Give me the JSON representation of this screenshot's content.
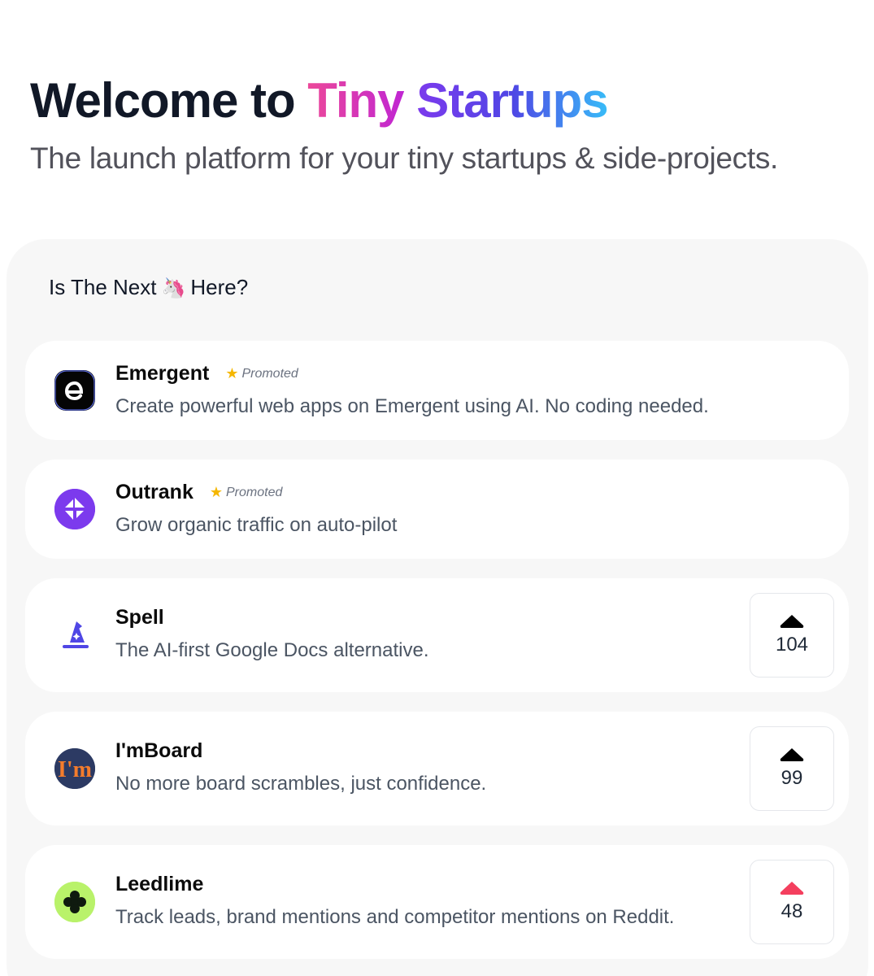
{
  "hero": {
    "title_prefix": "Welcome to ",
    "title_word1": "Tiny",
    "title_word2": "Startups",
    "subtitle": "The launch platform for your tiny startups & side-projects."
  },
  "section": {
    "title_before": "Is The Next",
    "emoji": "🦄",
    "title_after": "Here?"
  },
  "promoted_label": "Promoted",
  "products": [
    {
      "name": "Emergent",
      "description": "Create powerful web apps on Emergent using AI. No coding needed.",
      "promoted": true,
      "logo_icon": "emergent-logo-icon"
    },
    {
      "name": "Outrank",
      "description": "Grow organic traffic on auto-pilot",
      "promoted": true,
      "logo_icon": "outrank-logo-icon"
    },
    {
      "name": "Spell",
      "description": "The AI-first Google Docs alternative.",
      "promoted": false,
      "upvotes": "104",
      "upvote_color": "#000000",
      "logo_icon": "wizard-hat-icon"
    },
    {
      "name": "I'mBoard",
      "description": "No more board scrambles, just confidence.",
      "promoted": false,
      "upvotes": "99",
      "upvote_color": "#000000",
      "logo_icon": "imboard-logo-icon"
    },
    {
      "name": "Leedlime",
      "description": "Track leads, brand mentions and competitor mentions on Reddit.",
      "promoted": false,
      "upvotes": "48",
      "upvote_color": "#f43f5e",
      "logo_icon": "clover-icon"
    }
  ],
  "colors": {
    "tiny_gradient": [
      "#ec4899",
      "#c026d3"
    ],
    "startups_gradient": [
      "#7c3aed",
      "#4f46e5",
      "#38bdf8"
    ],
    "outrank_purple": "#7c3aed",
    "spell_blue": "#4f46e5",
    "imboard_navy": "#2c3a63",
    "imboard_orange": "#f47c2c",
    "leedlime_green": "#b9f26a",
    "upvoted_red": "#f43f5e"
  }
}
